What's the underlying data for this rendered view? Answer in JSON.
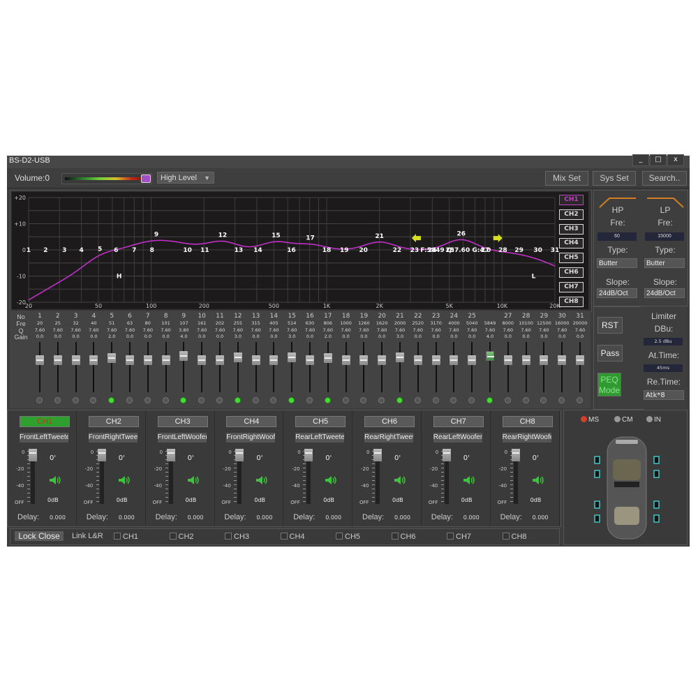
{
  "window": {
    "title": "BS-D2-USB",
    "controls": [
      "_",
      "□",
      "x"
    ]
  },
  "toolbar": {
    "volume_label": "Volume:0",
    "volume_level": 1.0,
    "input_mode": "High Level",
    "buttons": [
      "Mix Set",
      "Sys Set",
      "Search.."
    ]
  },
  "graph": {
    "y_ticks": [
      "+20",
      "+10",
      "0",
      "-10",
      "-20"
    ],
    "x_ticks": [
      "20",
      "50",
      "100",
      "200",
      "500",
      "1K",
      "2K",
      "5K",
      "10K",
      "20K"
    ],
    "hp_marker": "H",
    "lp_marker": "L",
    "tooltip": "F:5849 Q:7.60 G:4.0",
    "channels": [
      "CH1",
      "CH2",
      "CH3",
      "CH4",
      "CH5",
      "CH6",
      "CH7",
      "CH8"
    ],
    "active_channel": "CH1"
  },
  "filters": {
    "hp": {
      "title": "HP",
      "fre_label": "Fre:",
      "fre": "60",
      "type_label": "Type:",
      "type": "Butter",
      "slope_label": "Slope:",
      "slope": "24dB/Oct"
    },
    "lp": {
      "title": "LP",
      "fre_label": "Fre:",
      "fre": "15000",
      "type_label": "Type:",
      "type": "Butter",
      "slope_label": "Slope:",
      "slope": "24dB/Oct"
    }
  },
  "eq": {
    "row_labels": [
      "No",
      "Fre",
      "Q",
      "Gain"
    ],
    "selected_band": 26,
    "bands": [
      {
        "no": "1",
        "fre": "20",
        "q": "7.60",
        "gain": "0.0"
      },
      {
        "no": "2",
        "fre": "25",
        "q": "7.60",
        "gain": "0.0"
      },
      {
        "no": "3",
        "fre": "32",
        "q": "7.60",
        "gain": "0.0"
      },
      {
        "no": "4",
        "fre": "40",
        "q": "7.60",
        "gain": "0.0"
      },
      {
        "no": "5",
        "fre": "51",
        "q": "7.60",
        "gain": "2.0"
      },
      {
        "no": "6",
        "fre": "63",
        "q": "7.60",
        "gain": "0.0"
      },
      {
        "no": "7",
        "fre": "80",
        "q": "7.60",
        "gain": "0.0"
      },
      {
        "no": "8",
        "fre": "101",
        "q": "7.60",
        "gain": "0.0"
      },
      {
        "no": "9",
        "fre": "107",
        "q": "3.80",
        "gain": "4.0"
      },
      {
        "no": "10",
        "fre": "161",
        "q": "7.60",
        "gain": "0.0"
      },
      {
        "no": "11",
        "fre": "202",
        "q": "7.60",
        "gain": "0.0"
      },
      {
        "no": "12",
        "fre": "255",
        "q": "7.60",
        "gain": "3.0"
      },
      {
        "no": "13",
        "fre": "315",
        "q": "7.60",
        "gain": "0.0"
      },
      {
        "no": "14",
        "fre": "405",
        "q": "7.60",
        "gain": "0.0"
      },
      {
        "no": "15",
        "fre": "514",
        "q": "7.60",
        "gain": "3.0"
      },
      {
        "no": "16",
        "fre": "630",
        "q": "7.60",
        "gain": "0.0"
      },
      {
        "no": "17",
        "fre": "806",
        "q": "7.60",
        "gain": "2.0"
      },
      {
        "no": "18",
        "fre": "1000",
        "q": "7.60",
        "gain": "0.0"
      },
      {
        "no": "19",
        "fre": "1260",
        "q": "7.60",
        "gain": "0.0"
      },
      {
        "no": "20",
        "fre": "1620",
        "q": "7.60",
        "gain": "0.0"
      },
      {
        "no": "21",
        "fre": "2000",
        "q": "7.60",
        "gain": "3.0"
      },
      {
        "no": "22",
        "fre": "2520",
        "q": "7.60",
        "gain": "0.0"
      },
      {
        "no": "23",
        "fre": "3170",
        "q": "7.60",
        "gain": "0.0"
      },
      {
        "no": "24",
        "fre": "4000",
        "q": "7.60",
        "gain": "0.0"
      },
      {
        "no": "25",
        "fre": "5040",
        "q": "7.60",
        "gain": "0.0"
      },
      {
        "no": "26",
        "fre": "5849",
        "q": "7.60",
        "gain": "4.0"
      },
      {
        "no": "27",
        "fre": "8000",
        "q": "7.60",
        "gain": "0.0"
      },
      {
        "no": "28",
        "fre": "10100",
        "q": "7.60",
        "gain": "0.0"
      },
      {
        "no": "29",
        "fre": "12500",
        "q": "7.60",
        "gain": "0.0"
      },
      {
        "no": "30",
        "fre": "16000",
        "q": "7.60",
        "gain": "0.0"
      },
      {
        "no": "31",
        "fre": "20000",
        "q": "7.60",
        "gain": "0.0"
      }
    ]
  },
  "side_buttons": {
    "rst": "RST",
    "pass": "Pass",
    "peq_line1": "PEQ",
    "peq_line2": "Mode"
  },
  "limiter": {
    "title": "Limiter",
    "dbu_label": "DBu:",
    "dbu": "2.5 dBu",
    "at_label": "At.Time:",
    "at": "45ms",
    "re_label": "Re.Time:",
    "re": "Atk*8"
  },
  "output_channels": [
    {
      "label": "CH1",
      "name": "FrontLeftTweeter",
      "phase": "0'",
      "db": "0dB",
      "delay_label": "Delay:",
      "delay": "0.000",
      "active": true
    },
    {
      "label": "CH2",
      "name": "FrontRightTweeter",
      "phase": "0'",
      "db": "0dB",
      "delay_label": "Delay:",
      "delay": "0.000",
      "active": false
    },
    {
      "label": "CH3",
      "name": "FrontLeftWoofer",
      "phase": "0'",
      "db": "0dB",
      "delay_label": "Delay:",
      "delay": "0.000",
      "active": false
    },
    {
      "label": "CH4",
      "name": "FrontRightWoofer",
      "phase": "0'",
      "db": "0dB",
      "delay_label": "Delay:",
      "delay": "0.000",
      "active": false
    },
    {
      "label": "CH5",
      "name": "RearLeftTweeter",
      "phase": "0'",
      "db": "0dB",
      "delay_label": "Delay:",
      "delay": "0.000",
      "active": false
    },
    {
      "label": "CH6",
      "name": "RearRightTweeter",
      "phase": "0'",
      "db": "0dB",
      "delay_label": "Delay:",
      "delay": "0.000",
      "active": false
    },
    {
      "label": "CH7",
      "name": "RearLeftWoofer",
      "phase": "0'",
      "db": "0dB",
      "delay_label": "Delay:",
      "delay": "0.000",
      "active": false
    },
    {
      "label": "CH8",
      "name": "RearRightWoofer",
      "phase": "0'",
      "db": "0dB",
      "delay_label": "Delay:",
      "delay": "0.000",
      "active": false
    }
  ],
  "fader_scale": [
    "0",
    "-20",
    "-40",
    "OFF"
  ],
  "bottom": {
    "lock_label": "Lock Close",
    "link_label": "Link L&R",
    "link_channels": [
      "CH1",
      "CH2",
      "CH3",
      "CH4",
      "CH5",
      "CH6",
      "CH7",
      "CH8"
    ]
  },
  "position": {
    "modes": [
      "MS",
      "CM",
      "IN"
    ],
    "selected": "MS"
  },
  "colors": {
    "curve": "#c030c8",
    "active_led": "#44dd33",
    "arrow": "#d8e020",
    "filter_icon": "#d08020"
  }
}
